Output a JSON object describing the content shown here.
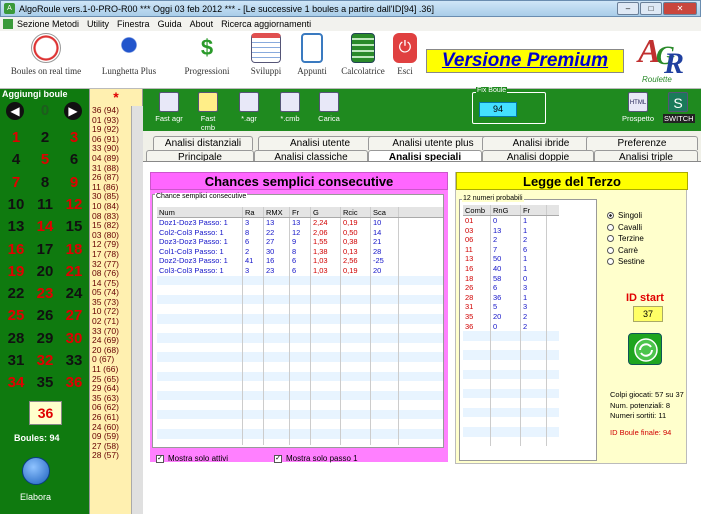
{
  "window": {
    "title": "AlgoRoule vers.1-0-PRO-R00  ***  Oggi 03 feb 2012  ***  - [Le successive 1 boules a partire dall'ID[94] .36]"
  },
  "menu": [
    "Sezione Metodi",
    "Utility",
    "Finestra",
    "Guida",
    "About",
    "Ricerca aggiornamenti"
  ],
  "toolbar": {
    "items": [
      "Boules on real time",
      "Lunghetta Plus",
      "Progressioni",
      "Sviluppi",
      "Appunti",
      "Calcolatrice",
      "Esci"
    ]
  },
  "premium": "Versione Premium",
  "brand": {
    "letters1": "A",
    "letters2": "G",
    "letters3": "R",
    "sub": "Roulette"
  },
  "left": {
    "title": "Aggiungi boule",
    "zero": "0",
    "last": "36",
    "boules": "Boules: 94",
    "elabora": "Elabora",
    "numbers": [
      [
        "1",
        "r"
      ],
      [
        "2",
        "b"
      ],
      [
        "3",
        "r"
      ],
      [
        "4",
        "b"
      ],
      [
        "5",
        "r"
      ],
      [
        "6",
        "b"
      ],
      [
        "7",
        "r"
      ],
      [
        "8",
        "b"
      ],
      [
        "9",
        "r"
      ],
      [
        "10",
        "b"
      ],
      [
        "11",
        "b"
      ],
      [
        "12",
        "r"
      ],
      [
        "13",
        "b"
      ],
      [
        "14",
        "r"
      ],
      [
        "15",
        "b"
      ],
      [
        "16",
        "r"
      ],
      [
        "17",
        "b"
      ],
      [
        "18",
        "r"
      ],
      [
        "19",
        "r"
      ],
      [
        "20",
        "b"
      ],
      [
        "21",
        "r"
      ],
      [
        "22",
        "b"
      ],
      [
        "23",
        "r"
      ],
      [
        "24",
        "b"
      ],
      [
        "25",
        "r"
      ],
      [
        "26",
        "b"
      ],
      [
        "27",
        "r"
      ],
      [
        "28",
        "b"
      ],
      [
        "29",
        "b"
      ],
      [
        "30",
        "r"
      ],
      [
        "31",
        "b"
      ],
      [
        "32",
        "r"
      ],
      [
        "33",
        "b"
      ],
      [
        "34",
        "r"
      ],
      [
        "35",
        "b"
      ],
      [
        "36",
        "r"
      ]
    ]
  },
  "history": {
    "star": "*",
    "items": [
      "36 (94)",
      "01 (93)",
      "19 (92)",
      "06 (91)",
      "33 (90)",
      "04 (89)",
      "31 (88)",
      "26 (87)",
      "11 (86)",
      "30 (85)",
      "10 (84)",
      "08 (83)",
      "15 (82)",
      "03 (80)",
      "12 (79)",
      "17 (78)",
      "32 (77)",
      "08 (76)",
      "14 (75)",
      "05 (74)",
      "35 (73)",
      "10 (72)",
      "02 (71)",
      "33 (70)",
      "24 (69)",
      "20 (68)",
      "0 (67)",
      "11 (66)",
      "25 (65)",
      "29 (64)",
      "35 (63)",
      "06 (62)",
      "26 (61)",
      "24 (60)",
      "09 (59)",
      "27 (58)",
      "28 (57)"
    ]
  },
  "tools": [
    "Fast agr",
    "Fast cmb",
    "*.agr",
    "*.cmb",
    "Carica",
    "Prospetto",
    "SWITCH"
  ],
  "fix": {
    "label": "Fix Boule",
    "value": "94"
  },
  "tabs_row1": [
    "Analisi distanziali",
    "Analisi utente",
    "Analisi utente plus",
    "Analisi ibride",
    "Preferenze"
  ],
  "tabs_row2": [
    "Principale",
    "Analisi classiche",
    "Analisi speciali",
    "Analisi doppie",
    "Analisi triple"
  ],
  "chances": {
    "title": "Chances semplici consecutive",
    "legend": "Chance semplici consecutive",
    "headers": [
      "Num",
      "Ra",
      "RMX",
      "Fr",
      "G",
      "Rcic",
      "Sca"
    ],
    "rows": [
      [
        "Doz1-Doz3  Passo: 1",
        "3",
        "13",
        "13",
        "2,24",
        "0,19",
        "10"
      ],
      [
        "Col2-Col3  Passo: 1",
        "8",
        "22",
        "12",
        "2,06",
        "0,50",
        "14"
      ],
      [
        "Doz3-Doz3  Passo: 1",
        "6",
        "27",
        "9",
        "1,55",
        "0,38",
        "21"
      ],
      [
        "Col1-Col3  Passo: 1",
        "2",
        "30",
        "8",
        "1,38",
        "0,13",
        "28"
      ],
      [
        "Doz2-Doz3  Passo: 1",
        "41",
        "16",
        "6",
        "1,03",
        "2,56",
        "-25"
      ],
      [
        "Col3-Col3  Passo: 1",
        "3",
        "23",
        "6",
        "1,03",
        "0,19",
        "20"
      ]
    ],
    "check1": "Mostra solo attivi",
    "check2": "Mostra solo passo 1"
  },
  "legge": {
    "title": "Legge del Terzo",
    "legend": "12 numeri probabili",
    "headers": [
      "Comb",
      "RnG",
      "Fr"
    ],
    "rows": [
      [
        "01",
        "0",
        "1"
      ],
      [
        "03",
        "13",
        "1"
      ],
      [
        "06",
        "2",
        "2"
      ],
      [
        "11",
        "7",
        "6"
      ],
      [
        "13",
        "50",
        "1"
      ],
      [
        "16",
        "40",
        "1"
      ],
      [
        "18",
        "58",
        "0"
      ],
      [
        "26",
        "6",
        "3"
      ],
      [
        "28",
        "36",
        "1"
      ],
      [
        "31",
        "5",
        "3"
      ],
      [
        "35",
        "20",
        "2"
      ],
      [
        "36",
        "0",
        "2"
      ]
    ],
    "radios": [
      "Singoli",
      "Cavalli",
      "Terzine",
      "Carrè",
      "Sestine"
    ],
    "id_label": "ID start",
    "id_value": "37",
    "stats": [
      "Colpi giocati: 57 su 37",
      "Num. potenziali: 8",
      "Numeri sortiti: 11"
    ],
    "id_finale": "ID Boule finale: 94"
  }
}
